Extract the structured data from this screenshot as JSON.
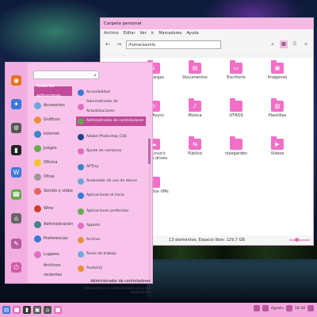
{
  "file_manager": {
    "title": "Carpeta personal",
    "menu": [
      "Archivo",
      "Editar",
      "Ver",
      "Ir",
      "Marcadores",
      "Ayuda"
    ],
    "path": "/home/samilo",
    "folders": [
      {
        "name": "Descargas",
        "icon": "download-icon"
      },
      {
        "name": "Documentos",
        "icon": "document-icon"
      },
      {
        "name": "Escritorio",
        "icon": "desktop-icon"
      },
      {
        "name": "Imágenes",
        "icon": "picture-icon"
      },
      {
        "name": "MEGAsync",
        "icon": "sync-icon"
      },
      {
        "name": "Música",
        "icon": "music-icon"
      },
      {
        "name": "OTROS",
        "icon": "folder-icon"
      },
      {
        "name": "Plantillas",
        "icon": "template-icon"
      },
      {
        "name": "PrOnLinux's Google drives",
        "icon": "cloud-icon"
      },
      {
        "name": "Público",
        "icon": "share-icon"
      },
      {
        "name": "rosegarden",
        "icon": "folder-icon"
      },
      {
        "name": "Vídeos",
        "icon": "video-icon"
      },
      {
        "name": "VirtualBox VMs",
        "icon": "folder-icon"
      }
    ],
    "status": "13 elementos, Espacio libre: 129,7 GB",
    "zoom_level": 0.35
  },
  "app_menu": {
    "search_placeholder": "",
    "categories": [
      {
        "label": "Todas las aplicaciones",
        "selected": true,
        "color": "#c04b9a"
      },
      {
        "label": "Accesorios",
        "color": "#6fa8dc"
      },
      {
        "label": "Gráficos",
        "color": "#e69138"
      },
      {
        "label": "Internet",
        "color": "#3d85c6"
      },
      {
        "label": "Juegos",
        "color": "#6aa84f"
      },
      {
        "label": "Oficina",
        "color": "#f1c232"
      },
      {
        "label": "Otras",
        "color": "#999999"
      },
      {
        "label": "Sonido y video",
        "color": "#e06666"
      },
      {
        "label": "Wine",
        "color": "#cc4125"
      },
      {
        "label": "Administración",
        "color": "#45818e"
      },
      {
        "label": "Preferencias",
        "color": "#3c78d8"
      },
      {
        "label": "Lugares",
        "color": "#e06fc0"
      },
      {
        "label": "Archivos recientes",
        "color": "#f8c4ec"
      }
    ],
    "apps": [
      {
        "label": "Accesibilidad",
        "color": "#3c78d8"
      },
      {
        "label": "Administrador de Actualizaciones",
        "color": "#e06fc0"
      },
      {
        "label": "Administrador de controladores",
        "color": "#6aa84f",
        "selected": true
      },
      {
        "label": "Adobe Photoshop CS6",
        "color": "#1c4587"
      },
      {
        "label": "Ajuste de ventanas",
        "color": "#e06fc0"
      },
      {
        "label": "APTray",
        "color": "#3d85c6"
      },
      {
        "label": "Analizador de uso de discos",
        "color": "#6fa8dc"
      },
      {
        "label": "Aplicaciones al inicio",
        "color": "#3c78d8"
      },
      {
        "label": "Aplicaciones preferidas",
        "color": "#6aa84f"
      },
      {
        "label": "Applets",
        "color": "#e06fc0"
      },
      {
        "label": "Archivo",
        "color": "#e69138"
      },
      {
        "label": "Áreas de trabajo",
        "color": "#6fa8dc"
      },
      {
        "label": "Audacity",
        "color": "#e69138"
      }
    ],
    "description_title": "Administrador de controladores",
    "description_text": "Administrar los controladores para sus dispositivos"
  },
  "launcher": [
    {
      "icon": "firefox-icon",
      "color": "#e8711c"
    },
    {
      "icon": "software-manager-icon",
      "color": "#3c78d8"
    },
    {
      "icon": "settings-icon",
      "color": "#555555"
    },
    {
      "icon": "terminal-icon",
      "color": "#222222"
    },
    {
      "icon": "writer-icon",
      "color": "#3c78d8"
    },
    {
      "icon": "phone-icon",
      "color": "#6aa84f"
    },
    {
      "icon": "network-icon",
      "color": "#666666"
    },
    {
      "icon": "tools-icon",
      "color": "#b75aa0"
    },
    {
      "icon": "power-icon",
      "color": "#d45aa8"
    }
  ],
  "taskbar": {
    "clock": "18:38",
    "keyboard_layout": "Agosto",
    "apps": [
      {
        "icon": "menu-icon",
        "color": "#3c78d8"
      },
      {
        "icon": "folder-icon",
        "color": "#e06fc0"
      },
      {
        "icon": "terminal-icon",
        "color": "#333333"
      },
      {
        "icon": "photos-icon",
        "color": "#555555"
      },
      {
        "icon": "network-icon",
        "color": "#555555"
      },
      {
        "icon": "folder-taskbar-icon",
        "color": "#e06fc0"
      }
    ]
  }
}
